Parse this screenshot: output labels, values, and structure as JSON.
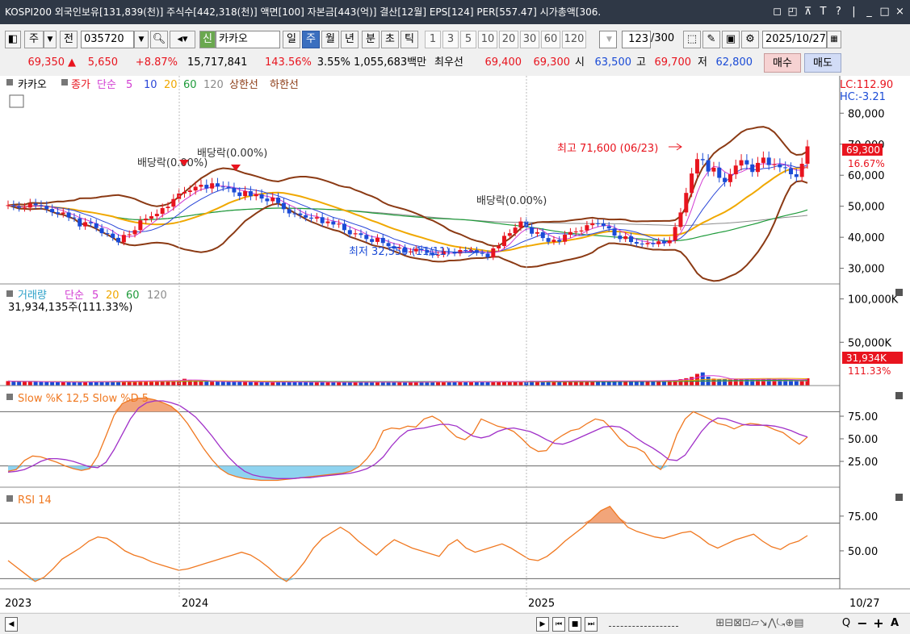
{
  "window": {
    "title": "KOSPI200 외국인보유[131,839(천)] 주식수[442,318(천)] 액면[100] 자본금[443(억)] 결산[12월] EPS[124] PER[557.47] 시가총액[306.",
    "controls": [
      "◻",
      "◰",
      "⊼",
      "T",
      "?",
      "|",
      "_",
      "□",
      "×"
    ]
  },
  "toolbar": {
    "market": "주",
    "period_mode": "전",
    "code": "035720",
    "new_badge": "신",
    "stock_name": "카카오",
    "period_tabs": [
      "일",
      "주",
      "월",
      "년",
      "분",
      "초",
      "틱"
    ],
    "active_period": "주",
    "number_tabs": [
      "1",
      "3",
      "5",
      "10",
      "20",
      "30",
      "60",
      "120"
    ],
    "count_value": "123",
    "count_total": "/300",
    "date_value": "2025/10/27"
  },
  "quote": {
    "price": "69,350",
    "change_arrow": "▲",
    "change": "5,650",
    "change_pct": "+8.87%",
    "volume": "15,717,841",
    "volume_ratio": "143.56%",
    "turnover": "3.55%",
    "amount": "1,055,683백만",
    "best_label": "최우선",
    "best_ask": "69,400",
    "best_bid": "69,300",
    "open_label": "시",
    "open": "63,500",
    "high_label": "고",
    "high": "69,700",
    "low_label": "저",
    "low": "62,800",
    "buy_label": "매수",
    "sell_label": "매도"
  },
  "colors": {
    "up": "#e8141e",
    "down": "#1a4bd6",
    "ma5": "#d23cd2",
    "ma10": "#2a46d8",
    "ma20": "#f0a800",
    "ma60": "#1e9b3a",
    "ma120": "#8c8c8c",
    "band": "#8b3a14",
    "stoch_k": "#f07820",
    "stoch_d": "#a030c8",
    "rsi": "#f07820"
  },
  "chart_data": [
    {
      "type": "candlestick",
      "legend": {
        "name": "카카오",
        "close_label": "종가",
        "ma_label": "단순",
        "periods": [
          "5",
          "10",
          "20",
          "60",
          "120"
        ],
        "upper_limit": "상한선",
        "lower_limit": "하한선"
      },
      "x_axis": {
        "ticks": [
          "2023",
          "2024",
          "2025"
        ],
        "last_label": "10/27"
      },
      "ylim": [
        26000,
        91000
      ],
      "y_ticks": [
        80000,
        70000,
        60000,
        50000,
        40000,
        30000
      ],
      "y_tick_labels": [
        "80,000",
        "70,000",
        "60,000",
        "50,000",
        "40,000",
        "30,000"
      ],
      "corner_labels": {
        "lc": "LC:112.90",
        "hc": "HC:-3.21"
      },
      "price_tag": "69,300",
      "pct_tag": "16.67%",
      "annotations": {
        "dividend_1": "배당락(0.00%)",
        "dividend_2": "배당락(0.00%)",
        "dividend_3": "배당락(0.00%)",
        "high": "최고 71,600 (06/23)",
        "low": "최저 32,550 (11/11)"
      },
      "n_weeks": 146,
      "close": [
        50340,
        49980,
        49500,
        49560,
        50880,
        50360,
        50100,
        49120,
        48060,
        47550,
        47980,
        46390,
        46120,
        43500,
        44870,
        44480,
        42960,
        41320,
        41180,
        39820,
        38370,
        40750,
        40960,
        42300,
        45460,
        46010,
        46790,
        47560,
        49400,
        49860,
        52330,
        54120,
        54600,
        55080,
        56280,
        56920,
        55720,
        57400,
        56340,
        56260,
        55920,
        54460,
        53280,
        54850,
        53240,
        53840,
        52480,
        51620,
        52780,
        51040,
        49050,
        47690,
        47660,
        47150,
        46330,
        46030,
        46470,
        44540,
        45090,
        44110,
        44360,
        42300,
        40960,
        41280,
        40750,
        39420,
        38510,
        39800,
        38150,
        37130,
        36370,
        36640,
        35140,
        35450,
        36290,
        35900,
        35020,
        34190,
        34390,
        35480,
        35340,
        34760,
        35880,
        35790,
        35860,
        34920,
        34720,
        33510,
        36420,
        37170,
        40460,
        41320,
        43120,
        45090,
        43260,
        41150,
        41640,
        39750,
        38520,
        39180,
        38560,
        40840,
        41690,
        41860,
        42180,
        43900,
        44500,
        44490,
        43590,
        42850,
        40530,
        39430,
        40310,
        38460,
        37950,
        37750,
        38160,
        37770,
        38700,
        38080,
        39010,
        43320,
        48000,
        54300,
        60560,
        65200,
        64840,
        61180,
        62430,
        59150,
        57770,
        60300,
        63120,
        64840,
        63480,
        61040,
        63980,
        65680,
        63290,
        63530,
        62560,
        62280,
        60310,
        59440,
        63700,
        69300
      ],
      "volume": [
        5200000,
        4800000,
        4600000,
        4500000,
        4700000,
        4600000,
        4400000,
        4300000,
        4200000,
        4000000,
        3900000,
        4200000,
        4100000,
        4000000,
        4300000,
        4400000,
        4600000,
        4800000,
        4900000,
        5200000,
        5100000,
        5200000,
        5300000,
        5000000,
        5400000,
        5200000,
        5600000,
        5700000,
        5600000,
        5700000,
        6000000,
        6200000,
        7800000,
        6500000,
        5800000,
        5000000,
        4600000,
        4500000,
        4500000,
        4600000,
        4700000,
        4500000,
        4300000,
        4200000,
        4100000,
        4000000,
        3900000,
        3800000,
        4000000,
        4300000,
        4400000,
        4200000,
        4100000,
        4000000,
        3900000,
        4000000,
        4100000,
        4000000,
        3900000,
        3800000,
        3700000,
        3800000,
        3900000,
        4000000,
        4000000,
        4100000,
        4200000,
        4300000,
        4100000,
        4000000,
        3900000,
        3800000,
        3700000,
        3900000,
        4200000,
        4500000,
        4600000,
        4400000,
        4300000,
        4200000,
        4400000,
        4500000,
        4600000,
        4400000,
        4300000,
        4200000,
        4100000,
        4400000,
        4700000,
        4600000,
        4800000,
        4700000,
        4500000,
        4400000,
        5000000,
        5400000,
        5300000,
        5200000,
        5100000,
        5000000,
        5200000,
        5400000,
        5600000,
        5600000,
        5300000,
        5200000,
        5100000,
        5400000,
        5500000,
        5300000,
        5200000,
        5400000,
        5200000,
        5000000,
        5100000,
        5400000,
        5500000,
        5600000,
        5800000,
        6000000,
        6200000,
        6500000,
        7400000,
        8500000,
        10000000,
        13500000,
        15200000,
        10200000,
        8000000,
        7400000,
        7200000,
        6800000,
        7200000,
        7600000,
        7200000,
        6800000,
        6800000,
        7400000,
        7800000,
        7000000,
        6900000,
        6800000,
        6600000,
        6400000,
        6800000,
        8400000
      ]
    },
    {
      "type": "bar",
      "legend": {
        "name": "거래량",
        "ma_label": "단순",
        "periods": [
          "5",
          "20",
          "60",
          "120"
        ]
      },
      "info": "31,934,135주(111.33%)",
      "ylim": [
        0,
        108000
      ],
      "y_ticks": [
        100000,
        50000
      ],
      "y_tick_labels": [
        "100,000K",
        "50,000K"
      ],
      "last_tag": "31,934K",
      "last_pct": "111.33%"
    },
    {
      "type": "line",
      "legend": "Slow %K 12,5   Slow %D 5",
      "ylim": [
        0,
        100
      ],
      "y_ticks": [
        75,
        50,
        25
      ],
      "y_tick_labels": [
        "75.00",
        "50.00",
        "25.00"
      ],
      "guides": [
        80,
        20
      ],
      "k": [
        14,
        16,
        26,
        31,
        30,
        27,
        24,
        20,
        17,
        15,
        17,
        31,
        53,
        76,
        89,
        93,
        95,
        95,
        93,
        90,
        86,
        78,
        67,
        53,
        39,
        27,
        17,
        11,
        8,
        6,
        5,
        4,
        4,
        4,
        5,
        6,
        7,
        8,
        9,
        10,
        11,
        12,
        14,
        19,
        28,
        40,
        59,
        62,
        61,
        64,
        63,
        72,
        75,
        70,
        60,
        52,
        49,
        56,
        72,
        68,
        64,
        62,
        58,
        50,
        41,
        36,
        37,
        48,
        54,
        59,
        61,
        67,
        72,
        70,
        61,
        50,
        42,
        40,
        35,
        22,
        16,
        30,
        55,
        72,
        80,
        76,
        72,
        67,
        65,
        61,
        65,
        67,
        66,
        64,
        60,
        57,
        50,
        44,
        52
      ],
      "d": [
        13,
        14,
        16,
        20,
        25,
        28,
        28,
        27,
        25,
        22,
        19,
        18,
        24,
        38,
        55,
        72,
        84,
        90,
        92,
        92,
        90,
        87,
        81,
        74,
        64,
        53,
        41,
        30,
        21,
        14,
        10,
        8,
        7,
        6,
        6,
        6,
        7,
        7,
        8,
        9,
        10,
        11,
        12,
        14,
        17,
        22,
        30,
        42,
        52,
        59,
        61,
        62,
        64,
        66,
        66,
        64,
        58,
        53,
        51,
        53,
        58,
        61,
        62,
        60,
        58,
        54,
        49,
        45,
        44,
        47,
        51,
        55,
        59,
        63,
        64,
        63,
        58,
        51,
        45,
        40,
        34,
        27,
        26,
        32,
        45,
        58,
        68,
        73,
        72,
        69,
        66,
        65,
        65,
        65,
        64,
        62,
        59,
        55,
        52
      ]
    },
    {
      "type": "line",
      "legend": "RSI 14",
      "ylim": [
        25,
        90
      ],
      "y_ticks": [
        75,
        50
      ],
      "y_tick_labels": [
        "75.00",
        "50.00"
      ],
      "guides": [
        70,
        30
      ],
      "rsi": [
        43,
        38,
        33,
        28,
        31,
        37,
        44,
        48,
        52,
        57,
        60,
        59,
        55,
        50,
        47,
        45,
        42,
        40,
        38,
        36,
        37,
        39,
        41,
        43,
        45,
        47,
        49,
        47,
        43,
        38,
        32,
        28,
        34,
        42,
        52,
        59,
        63,
        67,
        63,
        57,
        52,
        47,
        53,
        58,
        55,
        52,
        50,
        48,
        46,
        54,
        58,
        52,
        49,
        51,
        53,
        55,
        52,
        48,
        44,
        43,
        46,
        51,
        57,
        62,
        67,
        73,
        79,
        82,
        74,
        67,
        64,
        62,
        60,
        59,
        61,
        63,
        64,
        60,
        55,
        52,
        55,
        58,
        60,
        62,
        57,
        53,
        51,
        55,
        57,
        61
      ]
    }
  ],
  "bottom_bar": {
    "nav_buttons": [
      "▶",
      "⏮",
      "■",
      "⏭"
    ],
    "zoom_buttons": [
      "Q",
      "−",
      "+",
      "A"
    ]
  }
}
